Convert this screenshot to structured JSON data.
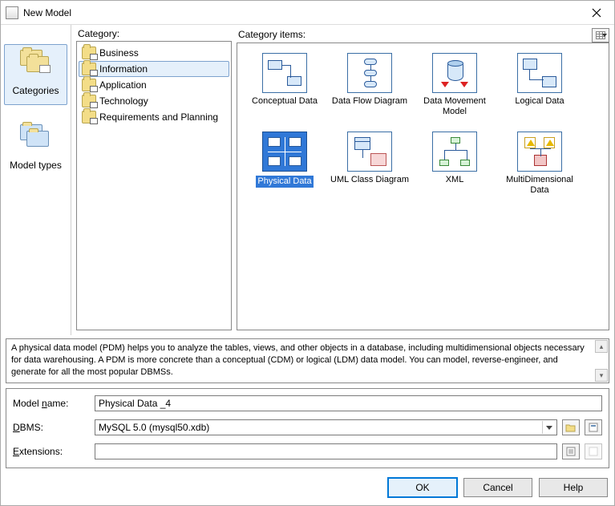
{
  "window": {
    "title": "New Model"
  },
  "sidebar": [
    {
      "label": "Categories",
      "selected": true
    },
    {
      "label": "Model types",
      "selected": false
    }
  ],
  "category_label": "Category:",
  "items_label": "Category items:",
  "categories": [
    {
      "label": "Business",
      "selected": false
    },
    {
      "label": "Information",
      "selected": true
    },
    {
      "label": "Application",
      "selected": false
    },
    {
      "label": "Technology",
      "selected": false
    },
    {
      "label": "Requirements and Planning",
      "selected": false
    }
  ],
  "category_items": [
    {
      "label": "Conceptual Data",
      "selected": false
    },
    {
      "label": "Data Flow Diagram",
      "selected": false
    },
    {
      "label": "Data Movement Model",
      "selected": false
    },
    {
      "label": "Logical Data",
      "selected": false
    },
    {
      "label": "Physical Data",
      "selected": true
    },
    {
      "label": "UML Class Diagram",
      "selected": false
    },
    {
      "label": "XML",
      "selected": false
    },
    {
      "label": "MultiDimensional Data",
      "selected": false
    }
  ],
  "description": "A physical data model (PDM) helps you to analyze the tables, views, and other objects in a database, including multidimensional objects necessary for data warehousing. A PDM is more concrete than a conceptual (CDM) or logical (LDM) data model. You can model, reverse-engineer, and generate for all the most popular DBMSs.",
  "form": {
    "model_name_label_pre": "Model ",
    "model_name_label_u": "n",
    "model_name_label_post": "ame:",
    "model_name_value": "Physical Data _4",
    "dbms_label_u": "D",
    "dbms_label_post": "BMS:",
    "dbms_value": "MySQL 5.0 (mysql50.xdb)",
    "extensions_label_u": "E",
    "extensions_label_post": "xtensions:",
    "extensions_value": ""
  },
  "buttons": {
    "ok": "OK",
    "cancel": "Cancel",
    "help": "Help"
  }
}
